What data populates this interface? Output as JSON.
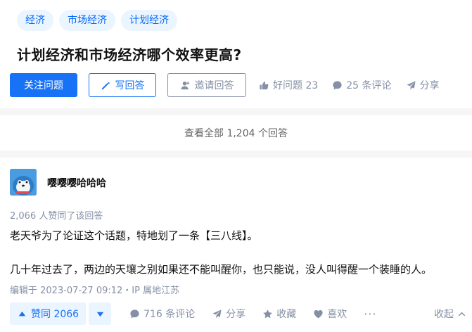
{
  "question": {
    "tags": [
      "经济",
      "市场经济",
      "计划经济"
    ],
    "title": "计划经济和市场经济哪个效率更高?",
    "follow_label": "关注问题",
    "answer_label": "写回答",
    "invite_label": "邀请回答",
    "good_question_label": "好问题 23",
    "comments_label": "25 条评论",
    "share_label": "分享"
  },
  "view_all": "查看全部 1,204 个回答",
  "answer": {
    "author": "嘤嘤嘤哈哈哈",
    "voters": "2,066 人赞同了该回答",
    "paragraphs": [
      "老天爷为了论证这个话题，特地划了一条【三八线】。",
      "几十年过去了，两边的天壤之别如果还不能叫醒你，也只能说，没人叫得醒一个装睡的人。"
    ],
    "edited": "编辑于 2023-07-27 09:12・IP 属地江苏",
    "actions": {
      "upvote_label": "赞同 2066",
      "comments_label": "716 条评论",
      "share_label": "分享",
      "favorite_label": "收藏",
      "like_label": "喜欢",
      "more_label": "···",
      "collapse_label": "收起"
    }
  },
  "colors": {
    "brand": "#1772f6",
    "tag_bg": "#ebf5ff",
    "muted": "#8590a6"
  }
}
